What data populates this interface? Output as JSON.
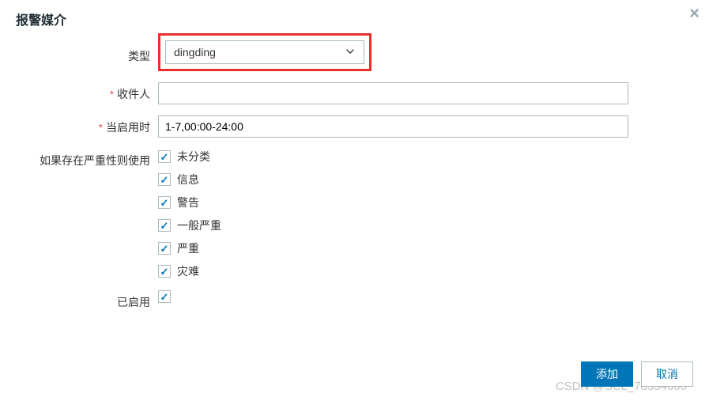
{
  "modal": {
    "title": "报警媒介",
    "close_symbol": "×"
  },
  "fields": {
    "type": {
      "label": "类型",
      "value": "dingding"
    },
    "recipient": {
      "label": "收件人",
      "value": ""
    },
    "when_active": {
      "label": "当启用时",
      "value": "1-7,00:00-24:00"
    },
    "severity": {
      "label": "如果存在严重性则使用",
      "options": [
        {
          "label": "未分类",
          "checked": true
        },
        {
          "label": "信息",
          "checked": true
        },
        {
          "label": "警告",
          "checked": true
        },
        {
          "label": "一般严重",
          "checked": true
        },
        {
          "label": "严重",
          "checked": true
        },
        {
          "label": "灾难",
          "checked": true
        }
      ]
    },
    "enabled": {
      "label": "已启用",
      "checked": true
    }
  },
  "buttons": {
    "add": "添加",
    "cancel": "取消"
  },
  "watermark": "CSDN @SCL_78534660"
}
